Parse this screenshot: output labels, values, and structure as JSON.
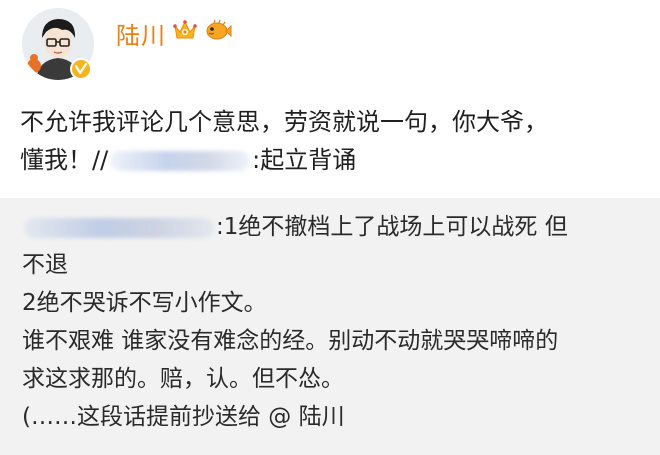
{
  "user": {
    "name": "陆川",
    "avatar_icon": "cartoon-avatar",
    "badge_icon": "verified-badge-icon",
    "badge_color": "#f6b51e",
    "name_color": "#ef7d13",
    "decorations": [
      "crown-icon",
      "pufferfish-icon"
    ]
  },
  "post": {
    "line1": "不允许我评论几个意思，劳资就说一句，你大爷，",
    "line2_before": "懂我！//",
    "line2_after": ":起立背诵"
  },
  "repost": {
    "line1_after": ":1绝不撤档上了战场上可以战死 但",
    "line2": "不退",
    "line3": "2绝不哭诉不写小作文。",
    "line4": "谁不艰难 谁家没有难念的经。别动不动就哭哭啼啼的",
    "line5": "求这求那的。赔，认。但不怂。",
    "line6": "(……这段话提前抄送给 @ 陆川"
  },
  "colors": {
    "repost_bg": "#f2f2f2",
    "text": "#1f1f1f"
  }
}
